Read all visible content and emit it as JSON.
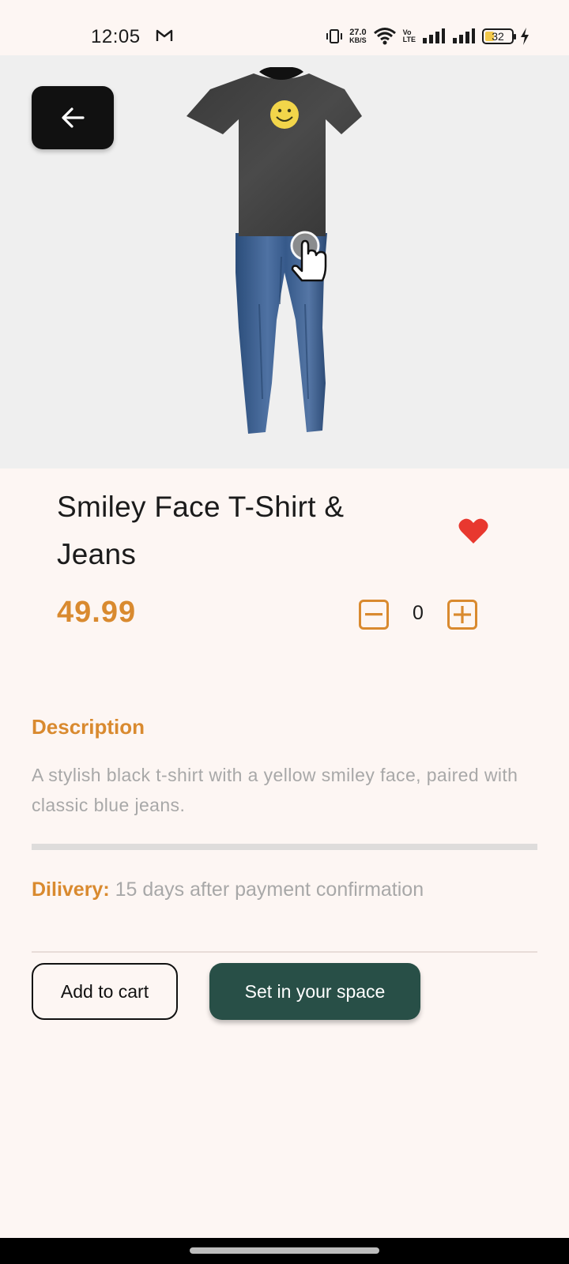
{
  "status_bar": {
    "time": "12:05",
    "net_speed_value": "27.0",
    "net_speed_unit": "KB/S",
    "volte_top": "Vo",
    "volte_bottom": "LTE",
    "battery": "32",
    "icons": [
      "gmail-icon",
      "vibrate-icon",
      "wifi-icon",
      "volte-icon",
      "signal-icon",
      "signal-icon",
      "battery-icon",
      "charging-icon"
    ]
  },
  "viewer": {
    "background": "#efefef",
    "icons": [
      "back-arrow-icon",
      "touch-hand-icon"
    ]
  },
  "product": {
    "title": "Smiley Face T-Shirt & Jeans",
    "price": "49.99",
    "quantity": "0",
    "favorite": true
  },
  "description": {
    "heading": "Description",
    "text": "A stylish black t-shirt with a yellow smiley face, paired with classic blue jeans."
  },
  "delivery": {
    "label": "Dilivery:",
    "value": "15 days after payment confirmation"
  },
  "actions": {
    "add_to_cart": "Add to cart",
    "set_in_space": "Set in your space"
  },
  "colors": {
    "accent": "#d98a2f",
    "primary_button": "#284f47",
    "heart": "#e8382f",
    "background": "#fdf6f3"
  }
}
